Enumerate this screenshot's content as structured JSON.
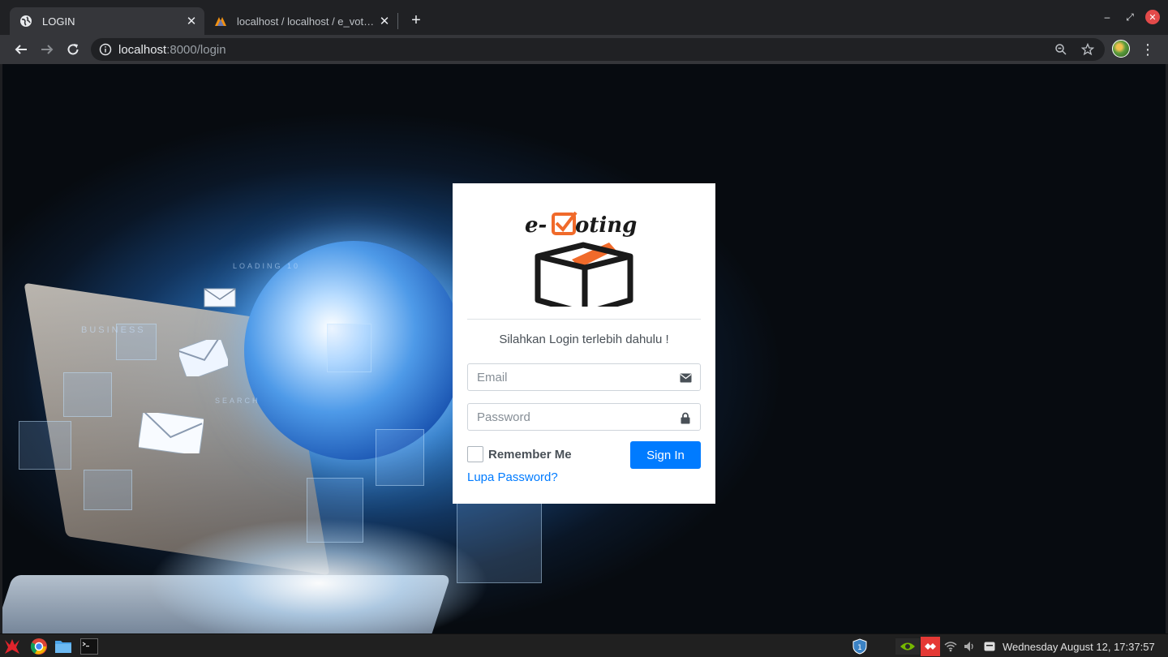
{
  "browser": {
    "tabs": [
      {
        "title": "LOGIN",
        "favicon": "globe-icon",
        "active": true
      },
      {
        "title": "localhost / localhost / e_vote / u",
        "favicon": "phpmyadmin-icon",
        "active": false
      }
    ],
    "url_host": "localhost",
    "url_rest": ":8000/login"
  },
  "page": {
    "logo_text": "e-Voting",
    "login_message": "Silahkan Login terlebih dahulu !",
    "email_placeholder": "Email",
    "password_placeholder": "Password",
    "remember_label": "Remember Me",
    "signin_label": "Sign In",
    "forgot_label": "Lupa Password?",
    "accent_color": "#007bff",
    "logo_orange": "#f06a2a"
  },
  "background": {
    "text_business": "BUSINESS",
    "text_loading": "LOADING 10",
    "text_search": "SEARCH"
  },
  "taskbar": {
    "clock": "Wednesday August 12, 17:37:57"
  }
}
